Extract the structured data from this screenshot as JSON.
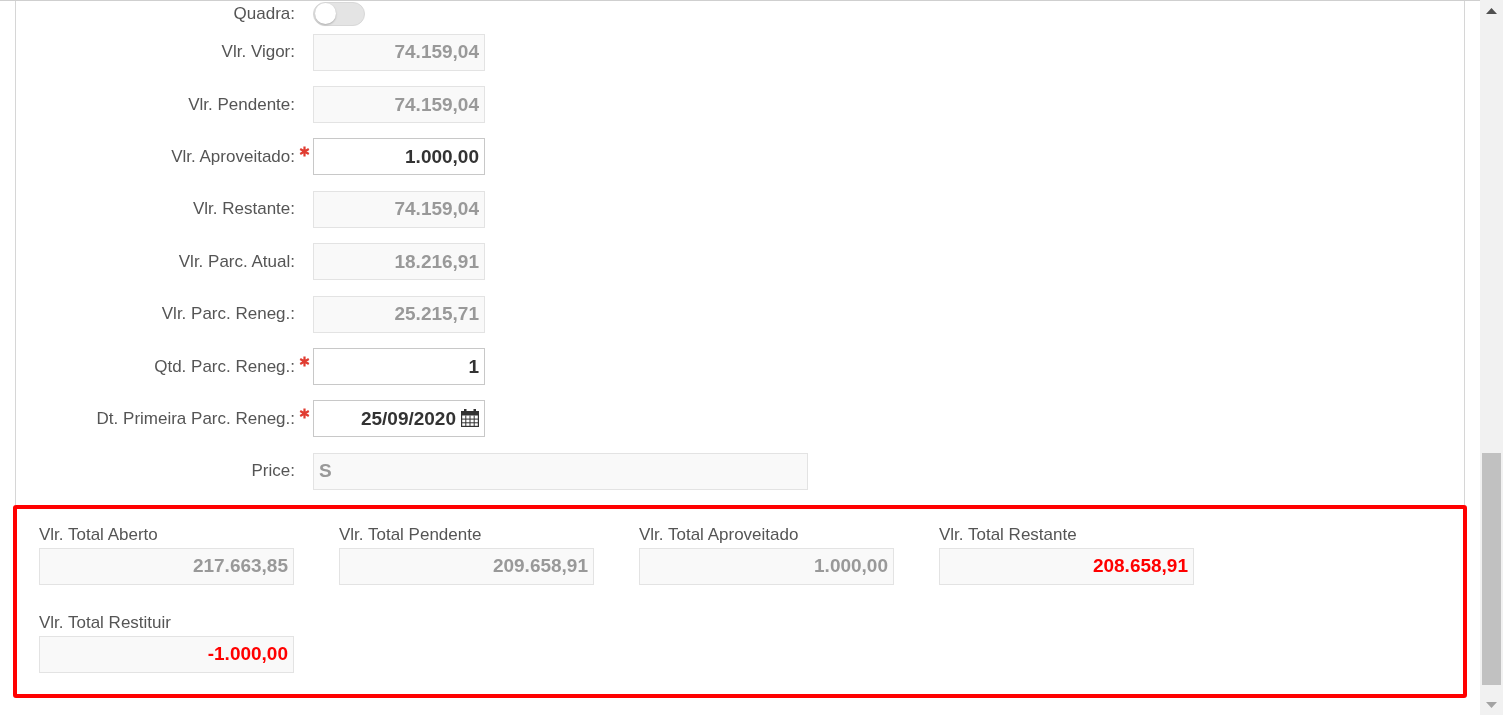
{
  "form": {
    "fields": [
      {
        "kind": "toggle",
        "label": "Quadra:",
        "on": false,
        "required": false
      },
      {
        "kind": "number",
        "label": "Vlr. Vigor:",
        "value": "74.159,04",
        "disabled": true,
        "required": false
      },
      {
        "kind": "number",
        "label": "Vlr. Pendente:",
        "value": "74.159,04",
        "disabled": true,
        "required": false
      },
      {
        "kind": "number",
        "label": "Vlr. Aproveitado:",
        "value": "1.000,00",
        "disabled": false,
        "required": true
      },
      {
        "kind": "number",
        "label": "Vlr. Restante:",
        "value": "74.159,04",
        "disabled": true,
        "required": false
      },
      {
        "kind": "number",
        "label": "Vlr. Parc. Atual:",
        "value": "18.216,91",
        "disabled": true,
        "required": false
      },
      {
        "kind": "number",
        "label": "Vlr. Parc. Reneg.:",
        "value": "25.215,71",
        "disabled": true,
        "required": false
      },
      {
        "kind": "number",
        "label": "Qtd. Parc. Reneg.:",
        "value": "1",
        "disabled": false,
        "required": true
      },
      {
        "kind": "date",
        "label": "Dt. Primeira Parc. Reneg.:",
        "value": "25/09/2020",
        "disabled": false,
        "required": true
      },
      {
        "kind": "text",
        "label": "Price:",
        "value": "S",
        "disabled": true,
        "required": false
      }
    ]
  },
  "totals": [
    {
      "label": "Vlr. Total Aberto",
      "value": "217.663,85",
      "highlighted": false
    },
    {
      "label": "Vlr. Total Pendente",
      "value": "209.658,91",
      "highlighted": false
    },
    {
      "label": "Vlr. Total Aproveitado",
      "value": "1.000,00",
      "highlighted": false
    },
    {
      "label": "Vlr. Total Restante",
      "value": "208.658,91",
      "highlighted": true
    },
    {
      "label": "Vlr. Total Restituir",
      "value": "-1.000,00",
      "highlighted": true
    }
  ]
}
